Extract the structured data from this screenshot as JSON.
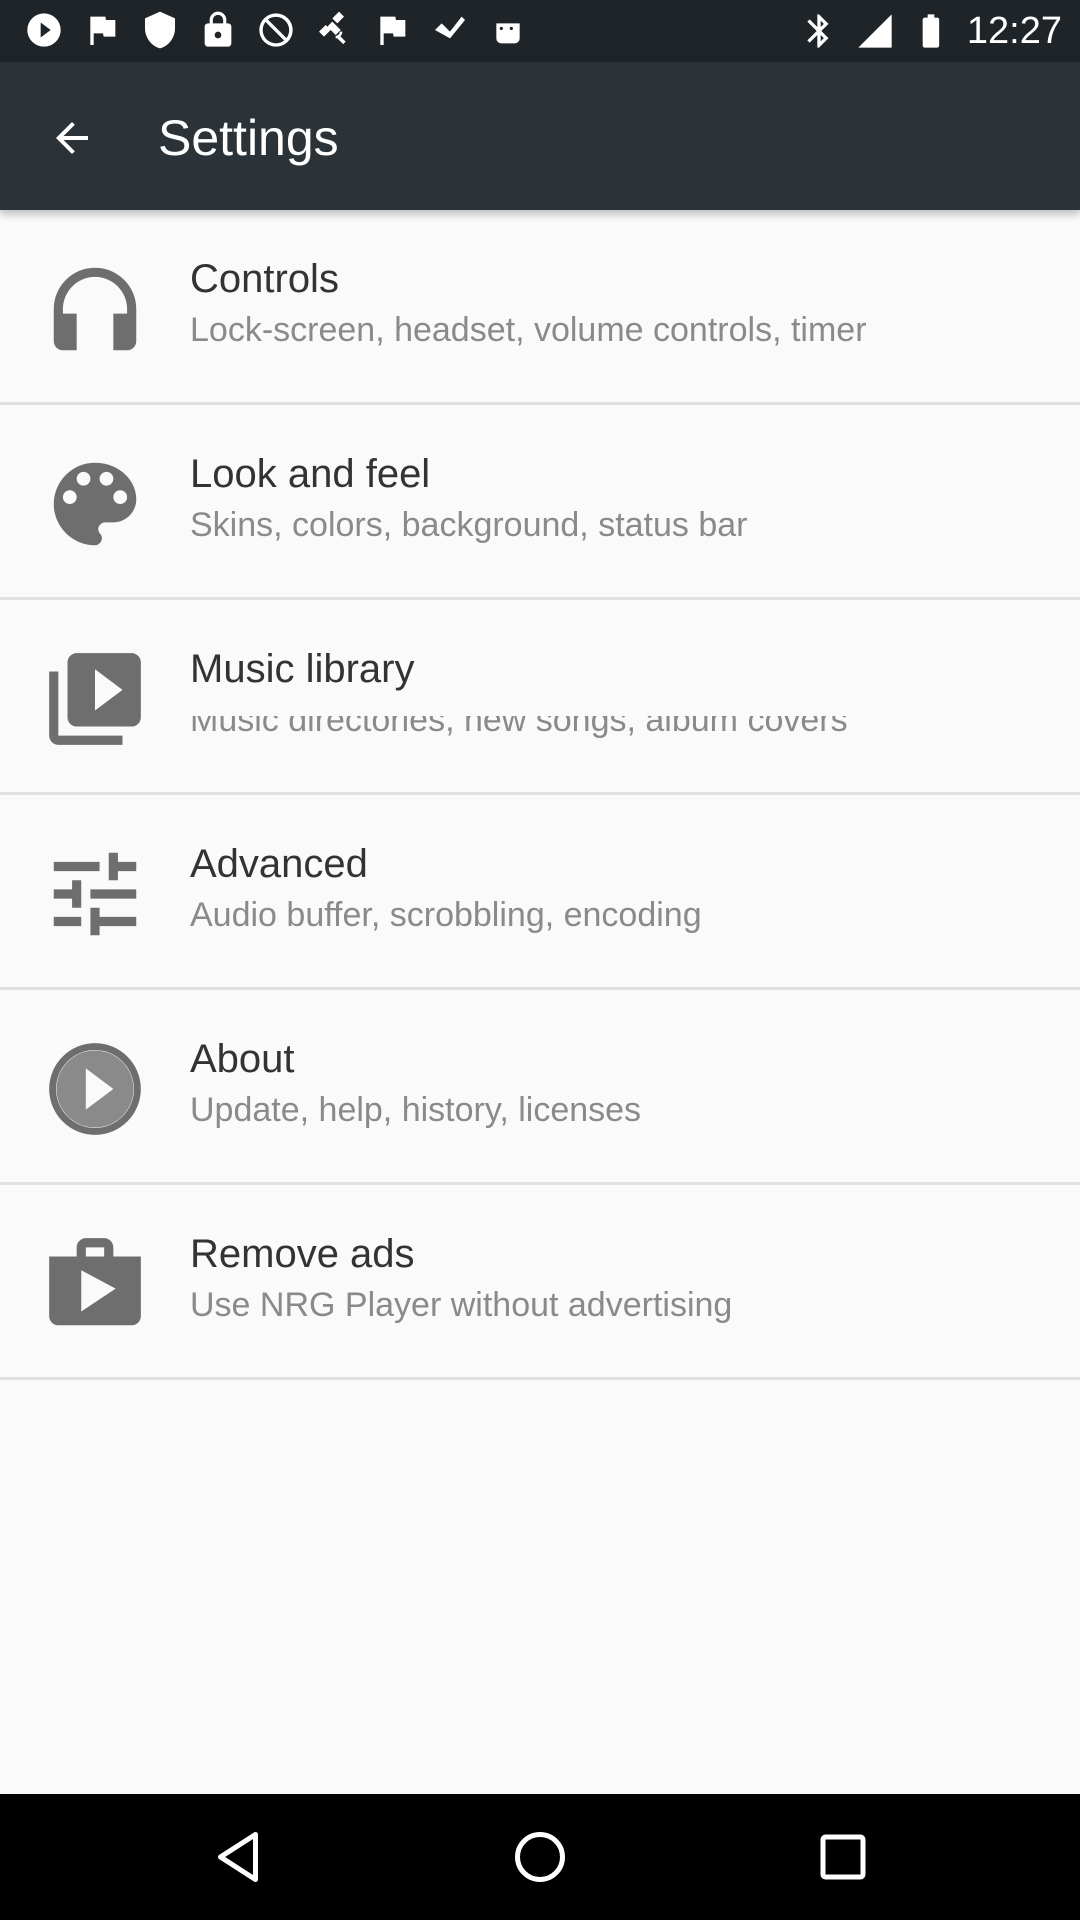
{
  "status_bar": {
    "time": "12:27",
    "left_icons": [
      "play-circle-icon",
      "flag-icon",
      "shield-icon",
      "lock-icon",
      "cancel-icon",
      "satellite-icon",
      "flag-icon",
      "download-icon",
      "android-icon"
    ],
    "right_icons": [
      "bluetooth-icon",
      "signal-icon",
      "battery-icon"
    ]
  },
  "app_bar": {
    "title": "Settings",
    "back_icon": "arrow-back-icon"
  },
  "settings_items": [
    {
      "icon": "headphones-icon",
      "title": "Controls",
      "subtitle": "Lock-screen, headset, volume controls, timer"
    },
    {
      "icon": "palette-icon",
      "title": "Look and feel",
      "subtitle": "Skins, colors, background, status bar"
    },
    {
      "icon": "video-library-icon",
      "title": "Music library",
      "subtitle": "Music directories, new songs, album covers"
    },
    {
      "icon": "tune-icon",
      "title": "Advanced",
      "subtitle": "Audio buffer, scrobbling, encoding"
    },
    {
      "icon": "play-circle-icon",
      "title": "About",
      "subtitle": "Update, help, history, licenses"
    },
    {
      "icon": "shop-icon",
      "title": "Remove ads",
      "subtitle": "Use NRG Player without advertising"
    }
  ],
  "nav_bar": {
    "buttons": [
      "back-triangle-icon",
      "home-circle-icon",
      "recents-square-icon"
    ]
  },
  "colors": {
    "status_bar_bg": "#1f2428",
    "app_bar_bg": "#2b3338",
    "background": "#fafafa",
    "icon": "#6e6e6e",
    "title_text": "#333333",
    "subtitle_text": "#8a8a8a"
  }
}
